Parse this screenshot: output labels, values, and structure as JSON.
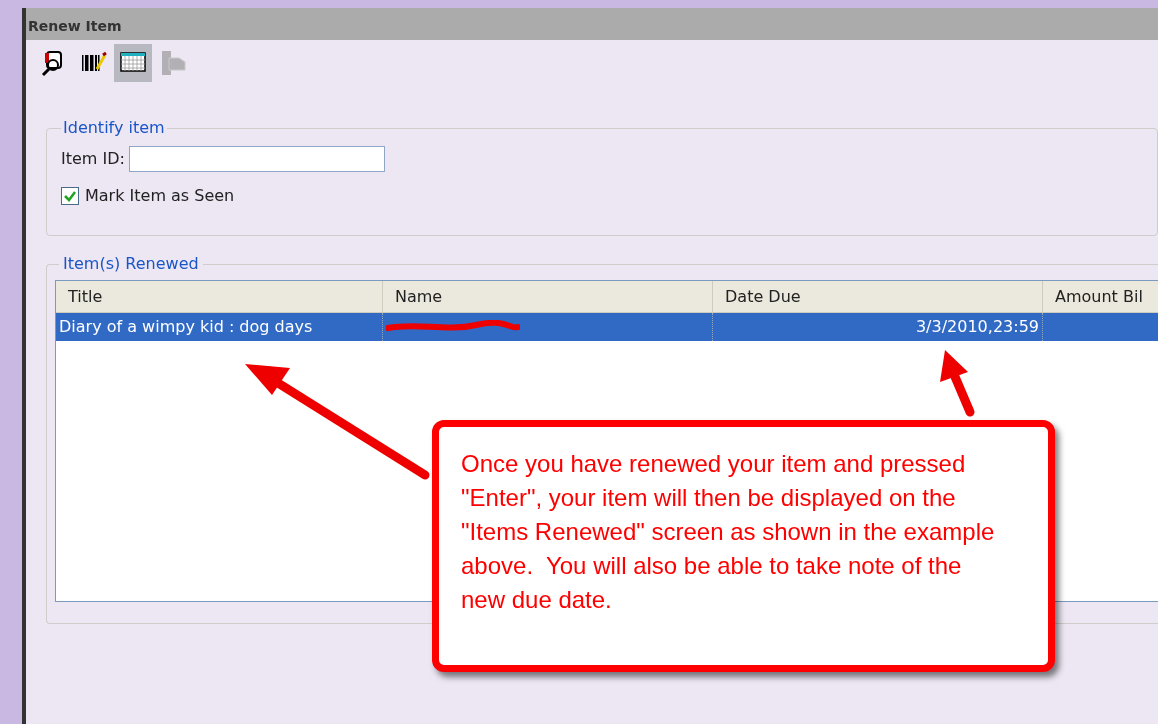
{
  "window": {
    "title": "Renew Item"
  },
  "toolbar": [
    {
      "kind": "search-user",
      "disabled": false,
      "selected": false
    },
    {
      "kind": "barcode",
      "disabled": false,
      "selected": false
    },
    {
      "kind": "grid",
      "disabled": false,
      "selected": true
    },
    {
      "kind": "hand",
      "disabled": true,
      "selected": false
    }
  ],
  "identify": {
    "legend": "Identify item",
    "item_id_label": "Item ID:",
    "mark_seen": {
      "label": "Mark Item as Seen",
      "checked": true
    }
  },
  "renewed": {
    "legend": "Item(s) Renewed",
    "columns": [
      "Title",
      "Name",
      "Date Due",
      "Amount Bil"
    ],
    "rows": [
      {
        "selected": true,
        "cells": [
          {
            "kind": "text",
            "text": "Diary of a wimpy kid : dog days"
          },
          {
            "kind": "redacted"
          },
          {
            "kind": "date",
            "text": "3/3/2010,23:59"
          },
          {
            "kind": "empty"
          }
        ]
      }
    ]
  },
  "callout": {
    "text": "Once you have renewed your item and pressed \"Enter\", your item will then be displayed on the \"Items Renewed\" screen as shown in the example above.  You will also be able to take note of the new due date."
  }
}
